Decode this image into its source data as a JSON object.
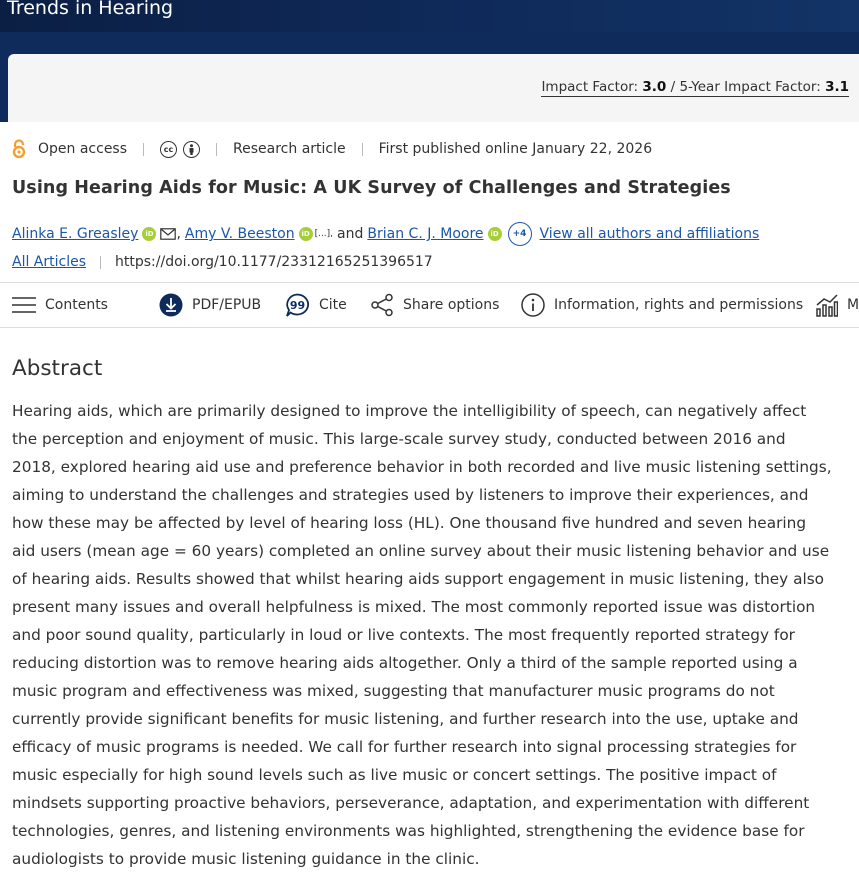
{
  "journal": {
    "title": "Trends in Hearing"
  },
  "impact": {
    "label1": "Impact Factor: ",
    "value1": "3.0",
    "divider": " / ",
    "label2": "5-Year Impact Factor: ",
    "value2": "3.1"
  },
  "meta": {
    "open_access": "Open access",
    "license_icons": [
      "cc",
      "by"
    ],
    "article_type": "Research article",
    "published": "First published online January 22, 2026"
  },
  "article": {
    "title": "Using Hearing Aids for Music: A UK Survey of Challenges and Strategies",
    "authors": [
      {
        "name": "Alinka E. Greasley",
        "orcid": true,
        "email": true
      },
      {
        "name": "Amy V. Beeston",
        "orcid": true
      },
      {
        "name": "Brian C. J. Moore",
        "orcid": true
      }
    ],
    "authors_sep1": ",",
    "authors_ellipsis": "[...],",
    "authors_and": "and",
    "more_authors": "+4",
    "view_all": "View all authors and affiliations",
    "all_articles": "All Articles",
    "doi": "https://doi.org/10.1177/23312165251396517"
  },
  "toolbar": {
    "contents": "Contents",
    "pdf": "PDF/EPUB",
    "cite": "Cite",
    "share": "Share options",
    "info": "Information, rights and permissions",
    "metrics": "M"
  },
  "abstract": {
    "heading": "Abstract",
    "text": "Hearing aids, which are primarily designed to improve the intelligibility of speech, can negatively affect the perception and enjoyment of music. This large-scale survey study, conducted between 2016 and 2018, explored hearing aid use and preference behavior in both recorded and live music listening settings, aiming to understand the challenges and strategies used by listeners to improve their experiences, and how these may be affected by level of hearing loss (HL). One thousand five hundred and seven hearing aid users (mean age = 60 years) completed an online survey about their music listening behavior and use of hearing aids. Results showed that whilst hearing aids support engagement in music listening, they also present many issues and overall helpfulness is mixed. The most commonly reported issue was distortion and poor sound quality, particularly in loud or live contexts. The most frequently reported strategy for reducing distortion was to remove hearing aids altogether. Only a third of the sample reported using a music program and effectiveness was mixed, suggesting that manufacturer music programs do not currently provide significant benefits for music listening, and further research into the use, uptake and efficacy of music programs is needed. We call for further research into signal processing strategies for music especially for high sound levels such as live music or concert settings. The positive impact of mindsets supporting proactive behaviors, perseverance, adaptation, and experimentation with different technologies, genres, and listening environments was highlighted, strengthening the evidence base for audiologists to provide music listening guidance in the clinic."
  },
  "colors": {
    "link": "#1b57a8",
    "banner": "#0e2b5b",
    "orcid": "#a6ce39",
    "open_access": "#f0a030"
  }
}
